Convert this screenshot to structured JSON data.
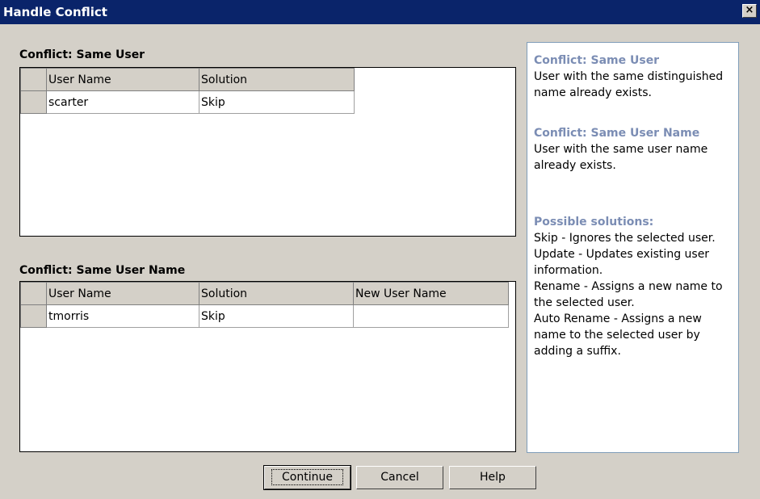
{
  "window": {
    "title": "Handle Conflict",
    "close_label": "×"
  },
  "same_user": {
    "label": "Conflict: Same User",
    "columns": [
      "User Name",
      "Solution"
    ],
    "rows": [
      {
        "user_name": "scarter",
        "solution": "Skip"
      }
    ]
  },
  "same_user_name": {
    "label": "Conflict: Same User Name",
    "columns": [
      "User Name",
      "Solution",
      "New User Name"
    ],
    "rows": [
      {
        "user_name": "tmorris",
        "solution": "Skip",
        "new_user_name": ""
      }
    ]
  },
  "help": {
    "same_user_heading": "Conflict: Same User",
    "same_user_text": "User with the same distinguished name already exists.",
    "same_name_heading": "Conflict: Same User Name",
    "same_name_text": "User with the same user name already exists.",
    "solutions_heading": "Possible solutions:",
    "solutions": [
      "Skip - Ignores the selected user.",
      "Update - Updates existing user information.",
      "Rename - Assigns a new name to the selected user.",
      "Auto Rename - Assigns a new name to the selected user by adding a suffix."
    ]
  },
  "buttons": {
    "continue": "Continue",
    "cancel": "Cancel",
    "help": "Help"
  },
  "icons": {
    "close": "close-icon"
  }
}
